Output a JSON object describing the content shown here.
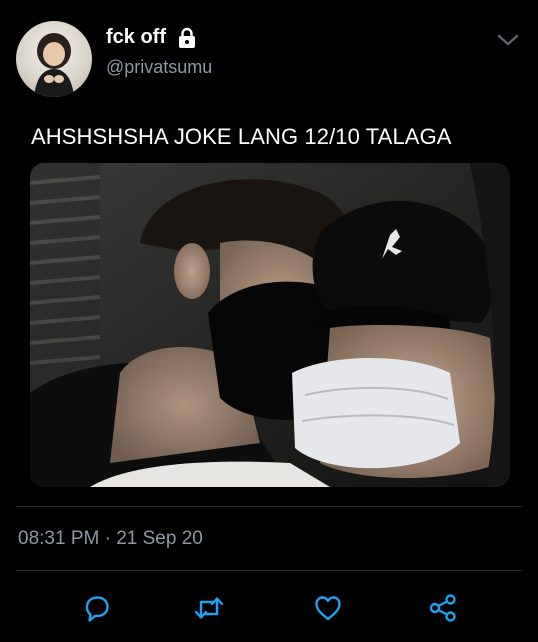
{
  "tweet": {
    "display_name": "fck off",
    "handle": "@privatsumu",
    "text": "AHSHSHSHA JOKE LANG 12/10 TALAGA",
    "timestamp": "08:31 PM · 21 Sep 20"
  },
  "icons": {
    "protected": "lock-icon",
    "more": "chevron-down-icon",
    "reply": "reply-icon",
    "retweet": "retweet-icon",
    "like": "heart-icon",
    "share": "share-icon"
  },
  "colors": {
    "background": "#000000",
    "text": "#ffffff",
    "secondary_text": "#8b98a5",
    "icon": "#1da1f2",
    "divider": "#1e2630"
  }
}
